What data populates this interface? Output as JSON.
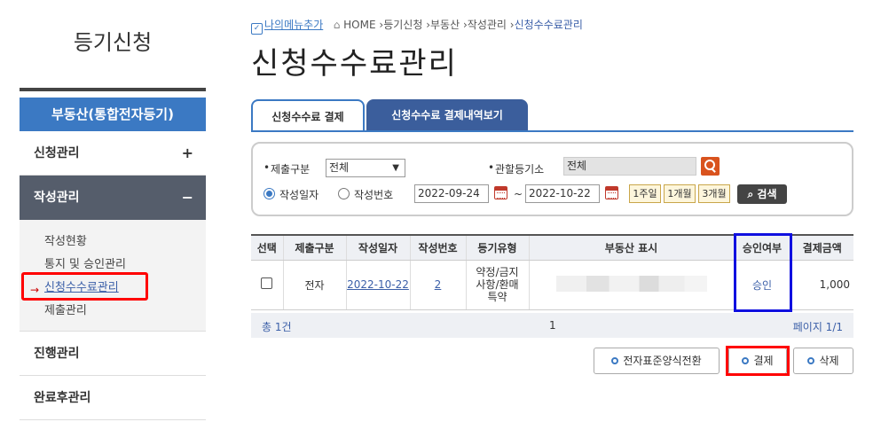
{
  "sidebar": {
    "title": "등기신청",
    "section_header": "부동산(통합전자등기)",
    "menu": {
      "apply": {
        "label": "신청관리",
        "toggle": "+"
      },
      "write": {
        "label": "작성관리",
        "toggle": "−"
      },
      "progress": {
        "label": "진행관리"
      },
      "complete": {
        "label": "완료후관리"
      }
    },
    "submenu": {
      "arrow": "→",
      "items": [
        "작성현황",
        "통지 및 승인관리",
        "신청수수료관리",
        "제출관리"
      ]
    }
  },
  "breadcrumb": {
    "favorite": "나의메뉴추가",
    "home": "HOME",
    "path": [
      "등기신청",
      "부동산",
      "작성관리"
    ],
    "current": "신청수수료관리",
    "separator": "›"
  },
  "page_title": "신청수수료관리",
  "tabs": [
    {
      "label": "신청수수료 결제",
      "active": true
    },
    {
      "label": "신청수수료 결제내역보기",
      "active": false
    }
  ],
  "search": {
    "submit_type_label": "제출구분",
    "submit_type_value": "전체",
    "office_label": "관할등기소",
    "office_value": "전체",
    "radio_date": "작성일자",
    "radio_number": "작성번호",
    "date_from": "2022-09-24",
    "tilde": "~",
    "date_to": "2022-10-22",
    "period_buttons": [
      "1주일",
      "1개월",
      "3개월"
    ],
    "search_button": "검색",
    "bullet": "•"
  },
  "table": {
    "headers": [
      "선택",
      "제출구분",
      "작성일자",
      "작성번호",
      "등기유형",
      "부동산 표시",
      "승인여부",
      "결제금액"
    ],
    "rows": [
      {
        "submit_type": "전자",
        "date": "2022-10-22",
        "number": "2",
        "type_lines": [
          "약정/금지",
          "사항/환매",
          "특약"
        ],
        "approval": "승인",
        "amount": "1,000"
      }
    ]
  },
  "footer": {
    "total": "총 1건",
    "current_page": "1",
    "page_info": "페이지 1/1"
  },
  "actions": {
    "convert": "전자표준양식전환",
    "pay": "결제",
    "delete": "삭제"
  },
  "colors": {
    "primary": "#3b79c3",
    "tab_dark": "#3b5e9c",
    "highlight_red": "#ff0000",
    "highlight_blue": "#1010e0"
  }
}
